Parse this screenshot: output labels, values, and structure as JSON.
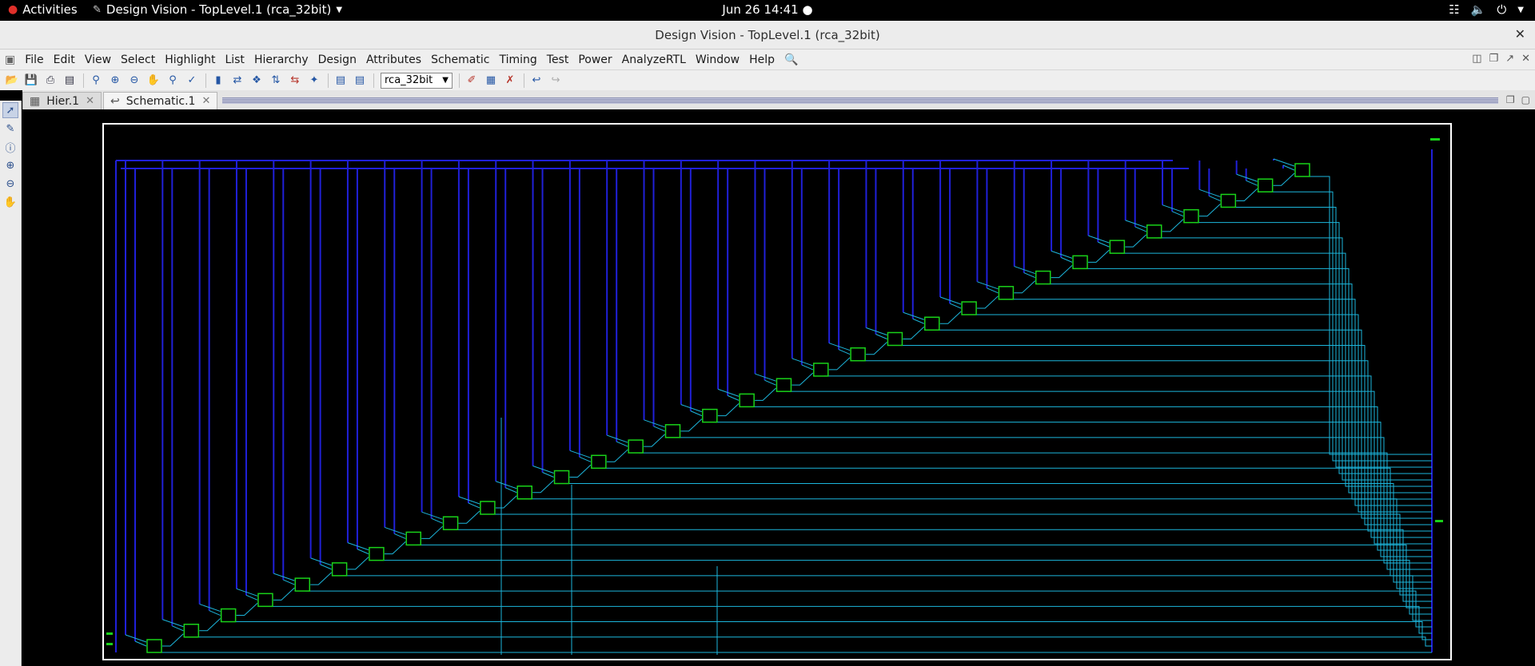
{
  "topbar": {
    "activities": "Activities",
    "app_menu": "Design Vision - TopLevel.1 (rca_32bit)",
    "clock": "Jun 26  14:41"
  },
  "window": {
    "title": "Design Vision - TopLevel.1 (rca_32bit)"
  },
  "menu": {
    "file": "File",
    "edit": "Edit",
    "view": "View",
    "select": "Select",
    "highlight": "Highlight",
    "list": "List",
    "hierarchy": "Hierarchy",
    "design": "Design",
    "attributes": "Attributes",
    "schematic": "Schematic",
    "timing": "Timing",
    "test": "Test",
    "power": "Power",
    "analyzertl": "AnalyzeRTL",
    "window": "Window",
    "help": "Help"
  },
  "toolbar": {
    "design_select": "rca_32bit"
  },
  "tabs": [
    {
      "label": "Hier.1"
    },
    {
      "label": "Schematic.1"
    }
  ],
  "schematic": {
    "cell_count": 32,
    "colors": {
      "background": "#000000",
      "frame": "#ffffff",
      "input_net": "#2020d8",
      "output_net": "#1cb6dc",
      "cell": "#19d219"
    }
  },
  "icons": {
    "activities": "redhat-icon",
    "network": "network-icon",
    "volume": "volume-icon",
    "power": "power-icon"
  }
}
